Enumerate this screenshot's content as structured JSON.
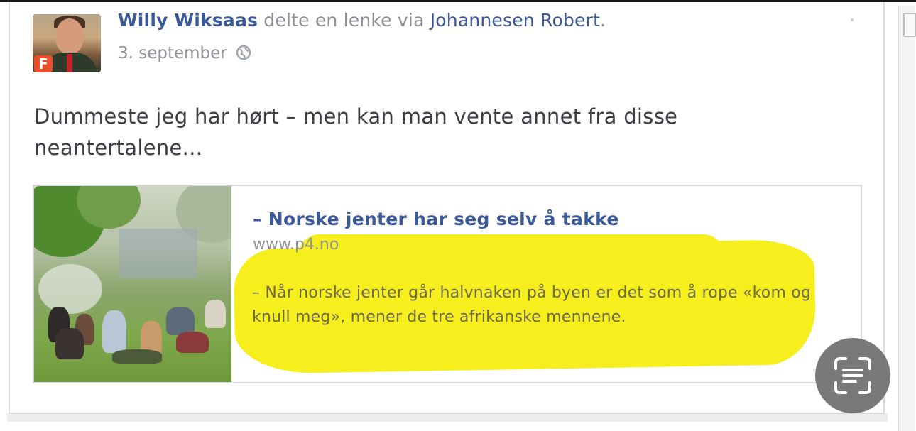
{
  "post": {
    "author": "Willy Wiksaas",
    "action": " delte en lenke via ",
    "via": "Johannesen Robert",
    "via_suffix": ".",
    "date": "3. september",
    "privacy_icon": "globe-icon",
    "message": "Dummeste jeg har hørt – men kan man vente annet fra disse neantertalene..."
  },
  "avatar": {
    "badge": "F"
  },
  "link_preview": {
    "title": "– Norske jenter har seg selv å takke",
    "domain": "www.p4.no",
    "description": "– Når norske jenter går halvnaken på byen er det som å rope «kom og knull meg», mener de tre afrikanske mennene."
  },
  "overlay": {
    "scan_icon": "text-scan-icon",
    "highlight_color": "#f7ee1e"
  },
  "colors": {
    "link": "#3b5998",
    "meta": "#90949c",
    "text": "#3a3d44"
  }
}
